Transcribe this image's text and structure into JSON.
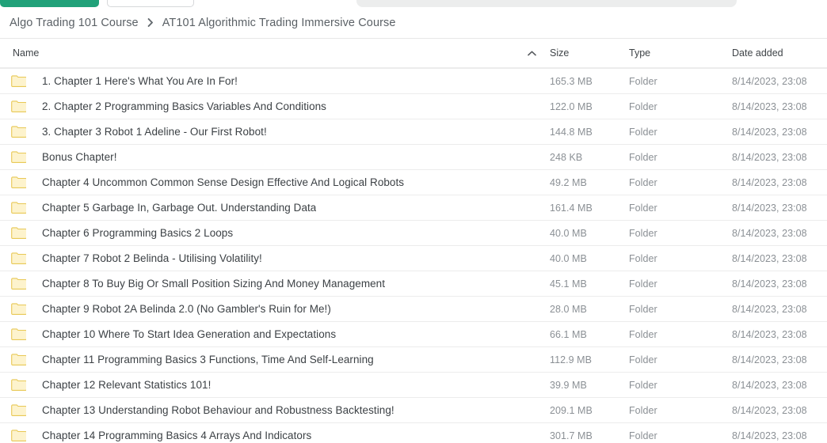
{
  "toolbar": {
    "primary_button_label": "",
    "secondary_button_label": "",
    "search_placeholder": ""
  },
  "breadcrumb": {
    "separator_icon": "chevron-right-icon",
    "items": [
      {
        "label": "Algo Trading 101 Course"
      },
      {
        "label": "AT101 Algorithmic Trading Immersive Course"
      }
    ]
  },
  "table": {
    "columns": {
      "name": "Name",
      "size": "Size",
      "type": "Type",
      "date_added": "Date added"
    },
    "sort": {
      "column": "name",
      "direction": "ascending",
      "icon": "chevron-up-icon"
    },
    "row_icon": "folder-icon",
    "rows": [
      {
        "name": "1. Chapter 1 Here's What You Are In For!",
        "size": "165.3 MB",
        "type": "Folder",
        "date_added": "8/14/2023, 23:08"
      },
      {
        "name": "2. Chapter 2 Programming Basics Variables And Conditions",
        "size": "122.0 MB",
        "type": "Folder",
        "date_added": "8/14/2023, 23:08"
      },
      {
        "name": "3. Chapter 3 Robot 1 Adeline - Our First Robot!",
        "size": "144.8 MB",
        "type": "Folder",
        "date_added": "8/14/2023, 23:08"
      },
      {
        "name": "Bonus Chapter!",
        "size": "248 KB",
        "type": "Folder",
        "date_added": "8/14/2023, 23:08"
      },
      {
        "name": "Chapter 4 Uncommon Common Sense Design Effective And Logical Robots",
        "size": "49.2 MB",
        "type": "Folder",
        "date_added": "8/14/2023, 23:08"
      },
      {
        "name": "Chapter 5 Garbage In, Garbage Out. Understanding Data",
        "size": "161.4 MB",
        "type": "Folder",
        "date_added": "8/14/2023, 23:08"
      },
      {
        "name": "Chapter 6 Programming Basics 2 Loops",
        "size": "40.0 MB",
        "type": "Folder",
        "date_added": "8/14/2023, 23:08"
      },
      {
        "name": "Chapter 7 Robot 2 Belinda - Utilising Volatility!",
        "size": "40.0 MB",
        "type": "Folder",
        "date_added": "8/14/2023, 23:08"
      },
      {
        "name": "Chapter 8 To Buy Big Or Small Position Sizing And Money Management",
        "size": "45.1 MB",
        "type": "Folder",
        "date_added": "8/14/2023, 23:08"
      },
      {
        "name": "Chapter 9 Robot 2A Belinda 2.0 (No Gambler's Ruin for Me!)",
        "size": "28.0 MB",
        "type": "Folder",
        "date_added": "8/14/2023, 23:08"
      },
      {
        "name": "Chapter 10 Where To Start Idea Generation and Expectations",
        "size": "66.1 MB",
        "type": "Folder",
        "date_added": "8/14/2023, 23:08"
      },
      {
        "name": "Chapter 11 Programming Basics 3 Functions, Time And Self-Learning",
        "size": "112.9 MB",
        "type": "Folder",
        "date_added": "8/14/2023, 23:08"
      },
      {
        "name": "Chapter 12 Relevant Statistics 101!",
        "size": "39.9 MB",
        "type": "Folder",
        "date_added": "8/14/2023, 23:08"
      },
      {
        "name": "Chapter 13 Understanding Robot Behaviour and Robustness Backtesting!",
        "size": "209.1 MB",
        "type": "Folder",
        "date_added": "8/14/2023, 23:08"
      },
      {
        "name": "Chapter 14 Programming Basics 4 Arrays And Indicators",
        "size": "301.7 MB",
        "type": "Folder",
        "date_added": "8/14/2023, 23:08"
      }
    ]
  },
  "colors": {
    "accent_green": "#21a179",
    "folder_fill": "#fdf3cd",
    "folder_stroke": "#e8c855",
    "name_text": "#3c4145",
    "meta_text": "#8b9095",
    "divider": "#ececec",
    "search_bg": "#eceded"
  }
}
